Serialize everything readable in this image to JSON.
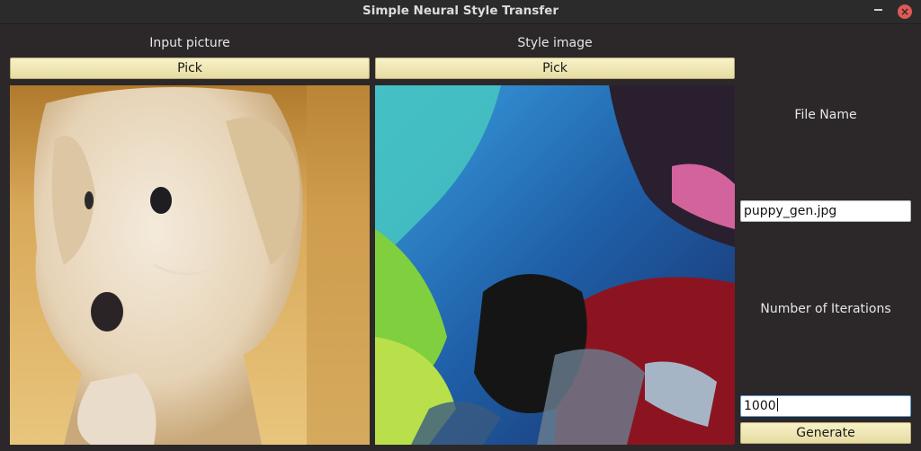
{
  "window": {
    "title": "Simple Neural Style Transfer"
  },
  "input_panel": {
    "label": "Input picture",
    "pick_label": "Pick"
  },
  "style_panel": {
    "label": "Style image",
    "pick_label": "Pick"
  },
  "output": {
    "file_name_label": "File Name",
    "file_name_value": "puppy_gen.jpg",
    "iterations_label": "Number of Iterations",
    "iterations_value": "1000",
    "generate_label": "Generate"
  },
  "icons": {
    "minimize": "minimize-icon",
    "close": "close-icon"
  },
  "colors": {
    "button_face": "#f2ebbd",
    "window_bg": "#2c2829",
    "close": "#e05a55"
  }
}
